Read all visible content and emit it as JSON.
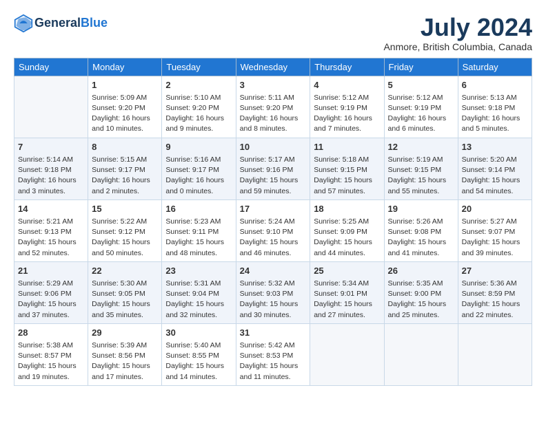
{
  "header": {
    "logo_line1": "General",
    "logo_line2": "Blue",
    "month": "July 2024",
    "location": "Anmore, British Columbia, Canada"
  },
  "weekdays": [
    "Sunday",
    "Monday",
    "Tuesday",
    "Wednesday",
    "Thursday",
    "Friday",
    "Saturday"
  ],
  "weeks": [
    [
      {
        "day": "",
        "info": ""
      },
      {
        "day": "1",
        "info": "Sunrise: 5:09 AM\nSunset: 9:20 PM\nDaylight: 16 hours\nand 10 minutes."
      },
      {
        "day": "2",
        "info": "Sunrise: 5:10 AM\nSunset: 9:20 PM\nDaylight: 16 hours\nand 9 minutes."
      },
      {
        "day": "3",
        "info": "Sunrise: 5:11 AM\nSunset: 9:20 PM\nDaylight: 16 hours\nand 8 minutes."
      },
      {
        "day": "4",
        "info": "Sunrise: 5:12 AM\nSunset: 9:19 PM\nDaylight: 16 hours\nand 7 minutes."
      },
      {
        "day": "5",
        "info": "Sunrise: 5:12 AM\nSunset: 9:19 PM\nDaylight: 16 hours\nand 6 minutes."
      },
      {
        "day": "6",
        "info": "Sunrise: 5:13 AM\nSunset: 9:18 PM\nDaylight: 16 hours\nand 5 minutes."
      }
    ],
    [
      {
        "day": "7",
        "info": "Sunrise: 5:14 AM\nSunset: 9:18 PM\nDaylight: 16 hours\nand 3 minutes."
      },
      {
        "day": "8",
        "info": "Sunrise: 5:15 AM\nSunset: 9:17 PM\nDaylight: 16 hours\nand 2 minutes."
      },
      {
        "day": "9",
        "info": "Sunrise: 5:16 AM\nSunset: 9:17 PM\nDaylight: 16 hours\nand 0 minutes."
      },
      {
        "day": "10",
        "info": "Sunrise: 5:17 AM\nSunset: 9:16 PM\nDaylight: 15 hours\nand 59 minutes."
      },
      {
        "day": "11",
        "info": "Sunrise: 5:18 AM\nSunset: 9:15 PM\nDaylight: 15 hours\nand 57 minutes."
      },
      {
        "day": "12",
        "info": "Sunrise: 5:19 AM\nSunset: 9:15 PM\nDaylight: 15 hours\nand 55 minutes."
      },
      {
        "day": "13",
        "info": "Sunrise: 5:20 AM\nSunset: 9:14 PM\nDaylight: 15 hours\nand 54 minutes."
      }
    ],
    [
      {
        "day": "14",
        "info": "Sunrise: 5:21 AM\nSunset: 9:13 PM\nDaylight: 15 hours\nand 52 minutes."
      },
      {
        "day": "15",
        "info": "Sunrise: 5:22 AM\nSunset: 9:12 PM\nDaylight: 15 hours\nand 50 minutes."
      },
      {
        "day": "16",
        "info": "Sunrise: 5:23 AM\nSunset: 9:11 PM\nDaylight: 15 hours\nand 48 minutes."
      },
      {
        "day": "17",
        "info": "Sunrise: 5:24 AM\nSunset: 9:10 PM\nDaylight: 15 hours\nand 46 minutes."
      },
      {
        "day": "18",
        "info": "Sunrise: 5:25 AM\nSunset: 9:09 PM\nDaylight: 15 hours\nand 44 minutes."
      },
      {
        "day": "19",
        "info": "Sunrise: 5:26 AM\nSunset: 9:08 PM\nDaylight: 15 hours\nand 41 minutes."
      },
      {
        "day": "20",
        "info": "Sunrise: 5:27 AM\nSunset: 9:07 PM\nDaylight: 15 hours\nand 39 minutes."
      }
    ],
    [
      {
        "day": "21",
        "info": "Sunrise: 5:29 AM\nSunset: 9:06 PM\nDaylight: 15 hours\nand 37 minutes."
      },
      {
        "day": "22",
        "info": "Sunrise: 5:30 AM\nSunset: 9:05 PM\nDaylight: 15 hours\nand 35 minutes."
      },
      {
        "day": "23",
        "info": "Sunrise: 5:31 AM\nSunset: 9:04 PM\nDaylight: 15 hours\nand 32 minutes."
      },
      {
        "day": "24",
        "info": "Sunrise: 5:32 AM\nSunset: 9:03 PM\nDaylight: 15 hours\nand 30 minutes."
      },
      {
        "day": "25",
        "info": "Sunrise: 5:34 AM\nSunset: 9:01 PM\nDaylight: 15 hours\nand 27 minutes."
      },
      {
        "day": "26",
        "info": "Sunrise: 5:35 AM\nSunset: 9:00 PM\nDaylight: 15 hours\nand 25 minutes."
      },
      {
        "day": "27",
        "info": "Sunrise: 5:36 AM\nSunset: 8:59 PM\nDaylight: 15 hours\nand 22 minutes."
      }
    ],
    [
      {
        "day": "28",
        "info": "Sunrise: 5:38 AM\nSunset: 8:57 PM\nDaylight: 15 hours\nand 19 minutes."
      },
      {
        "day": "29",
        "info": "Sunrise: 5:39 AM\nSunset: 8:56 PM\nDaylight: 15 hours\nand 17 minutes."
      },
      {
        "day": "30",
        "info": "Sunrise: 5:40 AM\nSunset: 8:55 PM\nDaylight: 15 hours\nand 14 minutes."
      },
      {
        "day": "31",
        "info": "Sunrise: 5:42 AM\nSunset: 8:53 PM\nDaylight: 15 hours\nand 11 minutes."
      },
      {
        "day": "",
        "info": ""
      },
      {
        "day": "",
        "info": ""
      },
      {
        "day": "",
        "info": ""
      }
    ]
  ]
}
